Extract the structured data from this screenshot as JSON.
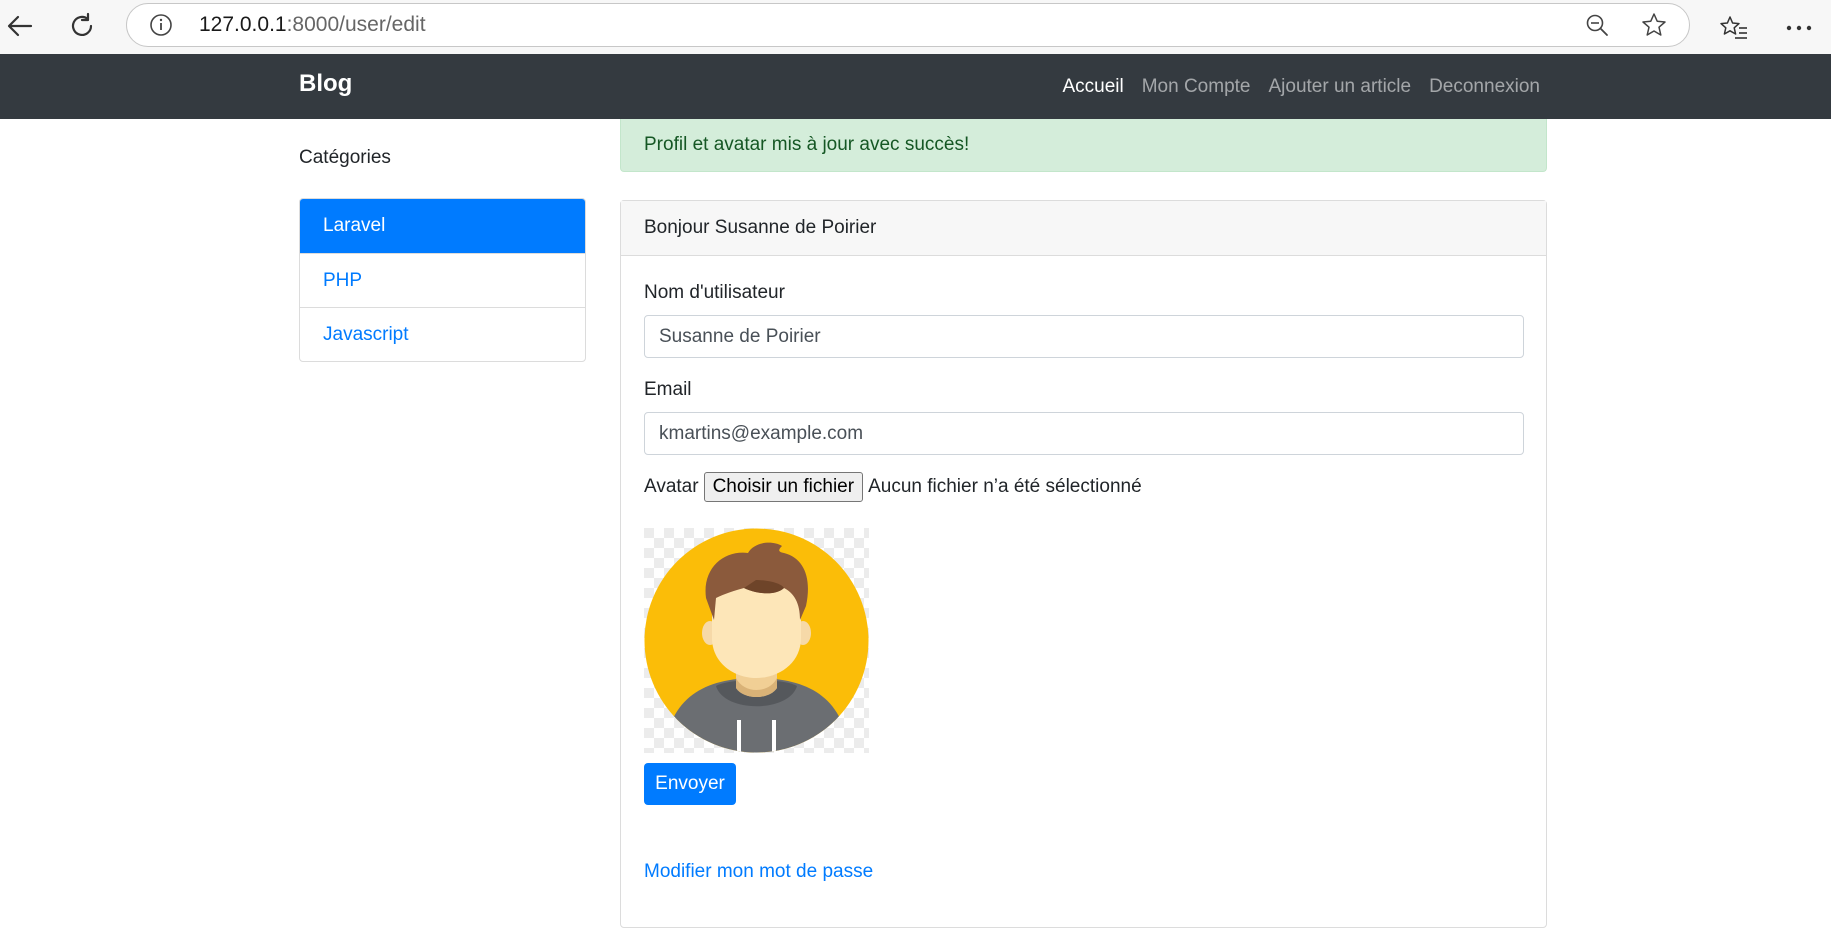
{
  "browser": {
    "url_host": "127.0.0.1",
    "url_rest": ":8000/user/edit",
    "icons": [
      "back-arrow-icon",
      "reload-icon",
      "info-icon",
      "zoom-out-icon",
      "favorite-star-icon",
      "favorites-list-icon",
      "more-icon"
    ]
  },
  "navbar": {
    "brand": "Blog",
    "items": [
      {
        "label": "Accueil",
        "active": true
      },
      {
        "label": "Mon Compte",
        "active": false
      },
      {
        "label": "Ajouter un article",
        "active": false
      },
      {
        "label": "Deconnexion",
        "active": false
      }
    ]
  },
  "sidebar": {
    "title": "Catégories",
    "items": [
      {
        "label": "Laravel",
        "active": true
      },
      {
        "label": "PHP",
        "active": false
      },
      {
        "label": "Javascript",
        "active": false
      }
    ]
  },
  "alert": {
    "message": "Profil et avatar mis à jour avec succès!"
  },
  "card": {
    "greeting": "Bonjour Susanne de Poirier",
    "username_label": "Nom d'utilisateur",
    "username_value": "Susanne de Poirier",
    "email_label": "Email",
    "email_value": "kmartins@example.com",
    "avatar_label": "Avatar",
    "file_button": "Choisir un fichier",
    "file_status": "Aucun fichier n’a été sélectionné",
    "submit": "Envoyer",
    "password_link": "Modifier mon mot de passe"
  },
  "colors": {
    "navbar": "#343a40",
    "primary": "#007bff",
    "alert_bg": "#d4edda",
    "avatar_bg": "#fbbd08"
  }
}
